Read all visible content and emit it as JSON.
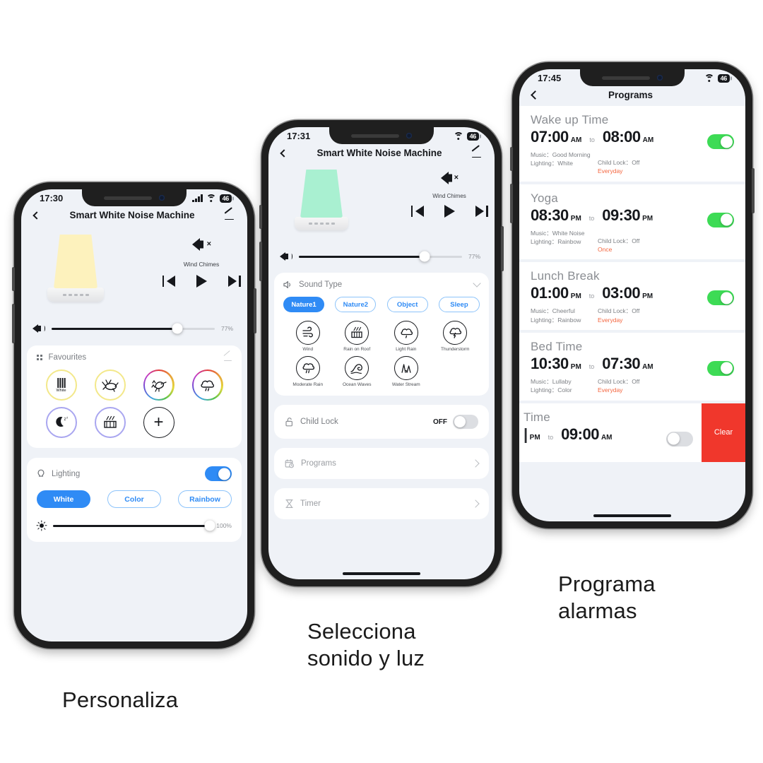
{
  "phone1": {
    "status": {
      "time": "17:30",
      "battery": "46",
      "signal_icon": "cellular-bars-icon",
      "wifi_icon": "wifi-icon"
    },
    "nav": {
      "back_icon": "back-chevron-icon",
      "title": "Smart White Noise Machine",
      "edit_icon": "pencil-icon"
    },
    "player": {
      "lamp_color": "#fdf2bd",
      "mute_icon": "speaker-muted-icon",
      "sound_name": "Wind Chimes",
      "prev_icon": "skip-previous-icon",
      "play_icon": "play-icon",
      "next_icon": "skip-next-icon",
      "volume_icon": "volume-icon",
      "volume_pct": "77%",
      "volume_value": 77
    },
    "favourites": {
      "grid_icon": "grid-icon",
      "title": "Favourites",
      "edit_icon": "pencil-icon",
      "items": [
        {
          "name": "white-noise-favourite",
          "label": "White",
          "ring": "yellow",
          "glyph": "white-bars-icon"
        },
        {
          "name": "cricket-favourite",
          "label": "",
          "ring": "yellow",
          "glyph": "cricket-icon"
        },
        {
          "name": "bird-favourite",
          "label": "",
          "ring": "rainbow",
          "glyph": "bird-icon"
        },
        {
          "name": "rain-cloud-favourite",
          "label": "",
          "ring": "rainbow",
          "glyph": "rain-cloud-icon"
        },
        {
          "name": "night-favourite",
          "label": "",
          "ring": "purple",
          "glyph": "moon-icon"
        },
        {
          "name": "rain-on-roof-favourite",
          "label": "",
          "ring": "purple",
          "glyph": "rain-on-roof-icon"
        }
      ],
      "add_label": "+"
    },
    "lighting": {
      "icon": "bulb-icon",
      "title": "Lighting",
      "toggle_state": "on",
      "modes": [
        {
          "label": "White",
          "selected": true
        },
        {
          "label": "Color",
          "selected": false
        },
        {
          "label": "Rainbow",
          "selected": false
        }
      ],
      "brightness_icon": "brightness-icon",
      "brightness_pct": "100%",
      "brightness_value": 100
    }
  },
  "phone2": {
    "status": {
      "time": "17:31",
      "battery": "46",
      "wifi_icon": "wifi-icon"
    },
    "nav": {
      "back_icon": "back-chevron-icon",
      "title": "Smart White Noise Machine",
      "edit_icon": "pencil-icon"
    },
    "player": {
      "lamp_color": "#a9f0d1",
      "mute_icon": "speaker-muted-icon",
      "sound_name": "Wind Chimes",
      "volume_pct": "77%",
      "volume_value": 77
    },
    "sound_type": {
      "icon": "sound-wave-icon",
      "title": "Sound Type",
      "collapse_icon": "chevron-down-icon",
      "categories": [
        {
          "label": "Nature1",
          "selected": true
        },
        {
          "label": "Nature2",
          "selected": false
        },
        {
          "label": "Object",
          "selected": false
        },
        {
          "label": "Sleep",
          "selected": false
        }
      ],
      "sounds": [
        {
          "label": "Wind",
          "glyph": "wind-icon"
        },
        {
          "label": "Rain on Roof",
          "glyph": "rain-on-roof-icon"
        },
        {
          "label": "Light Rain",
          "glyph": "light-rain-icon"
        },
        {
          "label": "Thunderstorm",
          "glyph": "thunderstorm-icon"
        },
        {
          "label": "Moderate Rain",
          "glyph": "moderate-rain-icon"
        },
        {
          "label": "Ocean Waves",
          "glyph": "ocean-waves-icon"
        },
        {
          "label": "Water Stream",
          "glyph": "water-stream-icon"
        }
      ]
    },
    "rows": {
      "child_lock": {
        "icon": "lock-open-icon",
        "label": "Child Lock",
        "value": "OFF",
        "toggle_state": "off"
      },
      "programs": {
        "icon": "calendar-clock-icon",
        "label": "Programs",
        "chevron": "chevron-right-icon"
      },
      "timer": {
        "icon": "hourglass-icon",
        "label": "Timer",
        "chevron": "chevron-right-icon"
      }
    }
  },
  "phone3": {
    "status": {
      "time": "17:45",
      "battery": "46",
      "wifi_icon": "wifi-icon"
    },
    "nav": {
      "back_icon": "back-chevron-icon",
      "title": "Programs"
    },
    "labels": {
      "to": "to",
      "music": "Music：",
      "lighting": "Lighting：",
      "child_lock": "Child Lock："
    },
    "programs": [
      {
        "name": "Wake up Time",
        "start_time": "07:00",
        "start_ampm": "AM",
        "end_time": "08:00",
        "end_ampm": "AM",
        "music": "Good Morning",
        "lighting": "White",
        "child_lock": "Off",
        "repeat": "Everyday",
        "toggle_state": "on"
      },
      {
        "name": "Yoga",
        "start_time": "08:30",
        "start_ampm": "PM",
        "end_time": "09:30",
        "end_ampm": "PM",
        "music": "White Noise",
        "lighting": "Rainbow",
        "child_lock": "Off",
        "repeat": "Once",
        "toggle_state": "on"
      },
      {
        "name": "Lunch Break",
        "start_time": "01:00",
        "start_ampm": "PM",
        "end_time": "03:00",
        "end_ampm": "PM",
        "music": "Cheerful",
        "lighting": "Rainbow",
        "child_lock": "Off",
        "repeat": "Everyday",
        "toggle_state": "on"
      },
      {
        "name": "Bed Time",
        "start_time": "10:30",
        "start_ampm": "PM",
        "end_time": "07:30",
        "end_ampm": "AM",
        "music": "Lullaby",
        "lighting": "Color",
        "child_lock": "Off",
        "repeat": "Everyday",
        "toggle_state": "on"
      }
    ],
    "swiped_row": {
      "name": "Time",
      "start_ampm": "PM",
      "to": "to",
      "end_time": "09:00",
      "end_ampm": "AM",
      "toggle_state": "off",
      "clear_label": "Clear"
    }
  },
  "captions": {
    "first": "Personaliza",
    "second_line1": "Selecciona",
    "second_line2": "sonido y luz",
    "third_line1": "Programa",
    "third_line2": "alarmas"
  },
  "colors": {
    "accent_blue": "#2f8bf5",
    "toggle_green": "#3ddb55",
    "repeat_orange": "#f4663f",
    "clear_red": "#f0372c",
    "screen_bg": "#eff2f7"
  }
}
